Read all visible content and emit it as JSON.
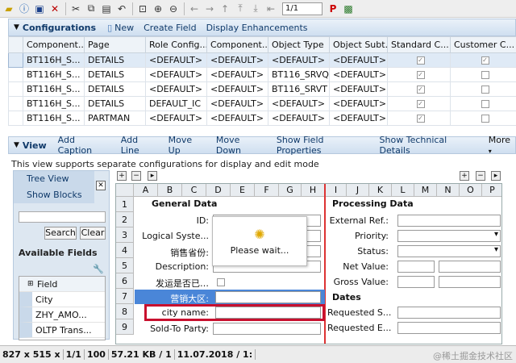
{
  "toolbar": {
    "page_value": "1/1"
  },
  "configurations": {
    "title": "Configurations",
    "actions": [
      "New",
      "Create Field",
      "Display Enhancements"
    ],
    "columns": [
      "Component...",
      "Page",
      "Role Config...",
      "Component...",
      "Object Type",
      "Object Subt...",
      "Standard C...",
      "Customer C..."
    ],
    "rows": [
      [
        "BT116H_S...",
        "DETAILS",
        "<DEFAULT>",
        "<DEFAULT>",
        "<DEFAULT>",
        "<DEFAULT>",
        true,
        true
      ],
      [
        "BT116H_S...",
        "DETAILS",
        "<DEFAULT>",
        "<DEFAULT>",
        "BT116_SRVQ",
        "<DEFAULT>",
        true,
        false
      ],
      [
        "BT116H_S...",
        "DETAILS",
        "<DEFAULT>",
        "<DEFAULT>",
        "BT116_SRVT",
        "<DEFAULT>",
        true,
        false
      ],
      [
        "BT116H_S...",
        "DETAILS",
        "DEFAULT_IC",
        "<DEFAULT>",
        "<DEFAULT>",
        "<DEFAULT>",
        true,
        false
      ],
      [
        "BT116H_S...",
        "PARTMAN",
        "<DEFAULT>",
        "<DEFAULT>",
        "<DEFAULT>",
        "<DEFAULT>",
        true,
        false
      ]
    ]
  },
  "view": {
    "title": "View",
    "actions": [
      "Add Caption",
      "Add Line",
      "Move Up",
      "Move Down",
      "Show Field Properties",
      "Show Technical Details",
      "More"
    ],
    "info": "This view supports separate configurations for display and edit mode"
  },
  "left_panel": {
    "tree_view": "Tree View",
    "show_blocks": "Show Blocks",
    "search_btn": "Search",
    "clear_btn": "Clear",
    "available_fields": "Available Fields",
    "field_header": "Field",
    "fields": [
      "City",
      "ZHY_AMO...",
      "OLTP Trans..."
    ]
  },
  "design": {
    "cols_left": [
      "A",
      "B",
      "C",
      "D",
      "E",
      "F",
      "G",
      "H"
    ],
    "cols_right": [
      "I",
      "J",
      "K",
      "L",
      "M",
      "N",
      "O",
      "P"
    ],
    "rows": [
      "1",
      "2",
      "3",
      "4",
      "5",
      "6",
      "7",
      "8",
      "9"
    ],
    "general_data": "General Data",
    "processing_data": "Processing Data",
    "dates": "Dates",
    "left_labels": [
      "ID:",
      "Logical Syste...",
      "销售省份:",
      "Description:",
      "发运是否已…",
      "营销大区:",
      "city name:",
      "Sold-To Party:"
    ],
    "right_labels": [
      "External Ref.:",
      "Priority:",
      "Status:",
      "Net Value:",
      "Gross Value:",
      "Requested S...",
      "Requested E..."
    ]
  },
  "wait_dialog": {
    "text": "Please wait..."
  },
  "status": {
    "items": [
      "827 x 515 x",
      "1/1",
      "100",
      "57.21 KB / 1",
      "11.07.2018 / 1:"
    ],
    "watermark": "@稀土掘金技术社区"
  }
}
